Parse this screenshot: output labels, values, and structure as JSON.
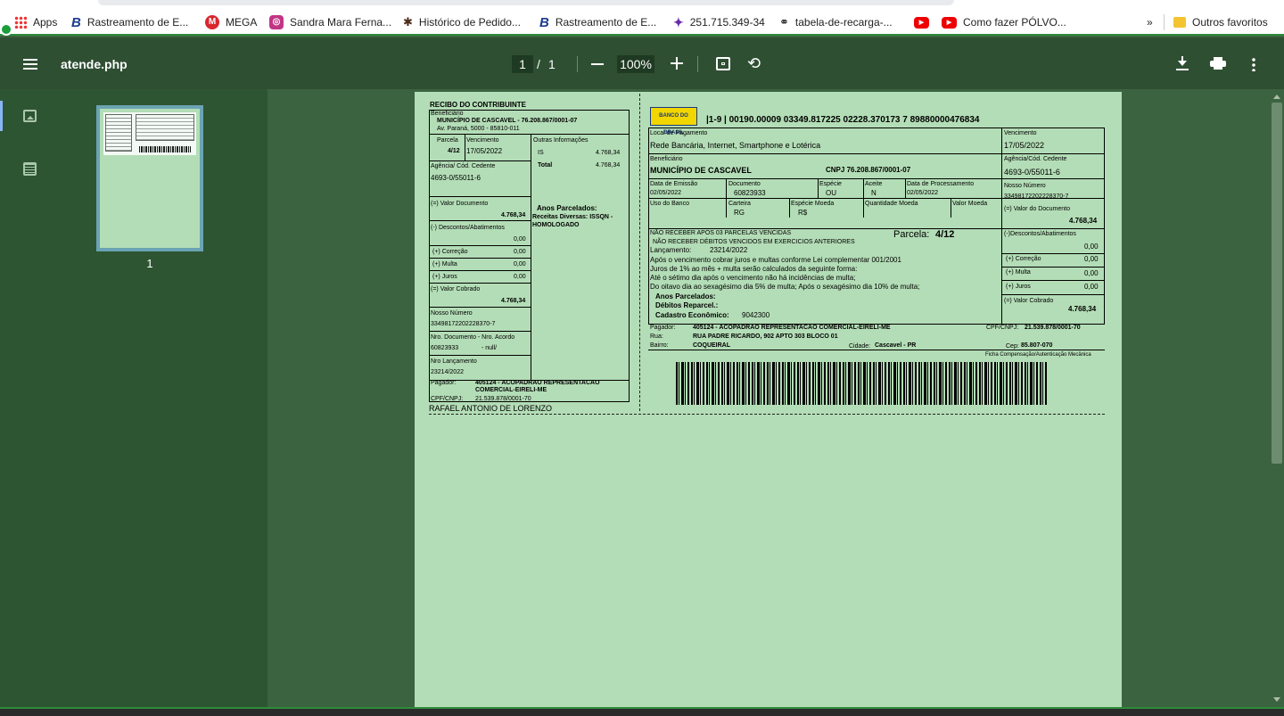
{
  "bookmarks": {
    "items": [
      {
        "label": "Apps",
        "icon": "apps-grid-icon"
      },
      {
        "label": "Rastreamento de E...",
        "icon": "b-logo-icon"
      },
      {
        "label": "MEGA",
        "icon": "mega-icon"
      },
      {
        "label": "Sandra Mara Ferna...",
        "icon": "instagram-icon"
      },
      {
        "label": "Histórico de Pedido...",
        "icon": "bee-icon"
      },
      {
        "label": "Rastreamento de E...",
        "icon": "b-logo-icon"
      },
      {
        "label": "251.715.349-34",
        "icon": "person-icon"
      },
      {
        "label": "tabela-de-recarga-...",
        "icon": "link-icon"
      },
      {
        "label": "",
        "icon": "youtube-icon"
      },
      {
        "label": "Como fazer PÓLVO...",
        "icon": "youtube-icon"
      }
    ],
    "more": "»",
    "other": "Outros favoritos"
  },
  "viewer": {
    "title": "atende.php",
    "page_current": "1",
    "page_sep": "/",
    "page_total": "1",
    "zoom": "100%",
    "thumb_label": "1"
  },
  "receipt": {
    "title": "RECIBO DO CONTRIBUINTE",
    "benef_label": "Beneficiário",
    "benef_name": "MUNICÍPIO  DE CASCAVEL - 76.208.867/0001-07",
    "benef_addr": "Av. Paraná, 5000 - 85810-011",
    "parcela_label": "Parcela",
    "parcela": "4/12",
    "venc_label": "Vencimento",
    "venc": "17/05/2022",
    "outras_label": "Outras Informações",
    "is_label": "IS",
    "is_value": "4.768,34",
    "total_label": "Total",
    "total_value": "4.768,34",
    "agencia_label": "Agência/ Cód. Cedente",
    "agencia": "4693-0/55011-6",
    "anos_title": "Anos Parcelados:",
    "anos_text1": "Receitas Diversas: ISSQN -",
    "anos_text2": "HOMOLOGADO",
    "valor_doc_label": "(=) Valor Documento",
    "valor_doc": "4.768,34",
    "desc_label": "(-) Descontos/Abatimentos",
    "desc": "0,00",
    "correcao_label": "(+) Correção",
    "correcao": "0,00",
    "multa_label": "(+) Multa",
    "multa": "0,00",
    "juros_label": "(+) Juros",
    "juros": "0,00",
    "cobrado_label": "(=) Valor Cobrado",
    "cobrado": "4.768,34",
    "nosso_label": "Nosso Número",
    "nosso": "33498172202228370-7",
    "nro_doc_label": "Nro. Documento - Nro. Acordo",
    "nro_doc": "60823933",
    "nro_acordo": "- null/",
    "nro_lanc_label": "Nro Lançamento",
    "nro_lanc": "23214/2022",
    "pagador_label": "Pagador:",
    "pagador_1": "405124 - ACOPADRAO REPRESENTACAO",
    "pagador_2": "COMERCIAL-EIRELI-ME",
    "cpf_label": "CPF/CNPJ:",
    "cpf": "21.539.878/0001-70",
    "signature": "RAFAEL ANTONIO DE LORENZO"
  },
  "boleto": {
    "bank_logo": "BANCO DO BRASIL",
    "linha": "|1-9 | 00190.00009 03349.817225 02228.370173 7 89880000476834",
    "local_label": "Local de Pagamento",
    "local": "Rede Bancária, Internet, Smartphone e Lotérica",
    "venc_label": "Vencimento",
    "venc": "17/05/2022",
    "benef_label": "Beneficiário",
    "benef": "MUNICÍPIO DE CASCAVEL",
    "cnpj": "CNPJ  76.208.867/0001-07",
    "agencia_label": "Agência/Cód. Cedente",
    "agencia": "4693-0/55011-6",
    "emissao_label": "Data de Emissão",
    "emissao": "02/05/2022",
    "doc_label": "Documento",
    "doc": "60823933",
    "especie_label": "Espécie",
    "especie": "OU",
    "aceite_label": "Aceite",
    "aceite": "N",
    "proc_label": "Data de Processamento",
    "proc": "02/05/2022",
    "nosso_label": "Nosso Número",
    "nosso": "33498172202228370-7",
    "uso_label": "Uso do Banco",
    "carteira_label": "Carteira",
    "carteira": "RG",
    "esp_moeda_label": "Espécie Moeda",
    "esp_moeda": "R$",
    "qtd_label": "Quantidade Moeda",
    "valor_moeda_label": "Valor Moeda",
    "valor_doc_label": "(=) Valor do Documento",
    "valor_doc": "4.768,34",
    "instr1": "NÃO RECEBER APÓS 03 PARCELAS VENCIDAS",
    "parcela_label": "Parcela:",
    "parcela": "4/12",
    "instr2": "NÃO RECEBER DÉBITOS VENCIDOS EM EXERCICIOS ANTERIORES",
    "lanc_label": "Lançamento:",
    "lanc": "23214/2022",
    "instr3": "Após o vencimento cobrar juros e multas conforme Lei complementar 001/2001",
    "instr4": "Juros de 1% ao mês + multa serão calculados da seguinte forma:",
    "instr5": "Até o sétimo dia após o vencimento não há incidências de multa;",
    "instr6": "Do oitavo dia ao sexagésimo dia 5% de multa; Após o sexagésimo dia 10% de multa;",
    "anos": "Anos Parcelados:",
    "debitos": "Débitos Reparcel.:",
    "cadastro_label": "Cadastro Econômico:",
    "cadastro": "9042300",
    "desc_label": "(-)Descontos/Abatimentos",
    "desc": "0,00",
    "correcao_label": "(+) Correção",
    "correcao": "0,00",
    "multa_label": "(+) Multa",
    "multa": "0,00",
    "juros_label": "(+) Juros",
    "juros": "0,00",
    "cobrado_label": "(=) Valor Cobrado",
    "cobrado": "4.768,34",
    "pagador_label": "Pagador:",
    "pagador": "405124 - ACOPADRAO REPRESENTACAO COMERCIAL-EIRELI-ME",
    "cpf_label": "CPF/CNPJ:",
    "cpf": "21.539.878/0001-70",
    "rua_label": "Rua:",
    "rua": "RUA PADRE RICARDO, 902 APTO 303 BLOCO 01",
    "bairro_label": "Bairro:",
    "bairro": "COQUEIRAL",
    "cidade_label": "Cidade:",
    "cidade": "Cascavel - PR",
    "cep_label": "Cep:",
    "cep": "85.807-070",
    "ficha": "Ficha Compensação/Autenticação Mecânica"
  },
  "colors": {
    "toolbar": "#2f4f33",
    "viewer_bg": "#3c6340",
    "page": "#b3ddb6",
    "sidebar": "#2e5532"
  }
}
